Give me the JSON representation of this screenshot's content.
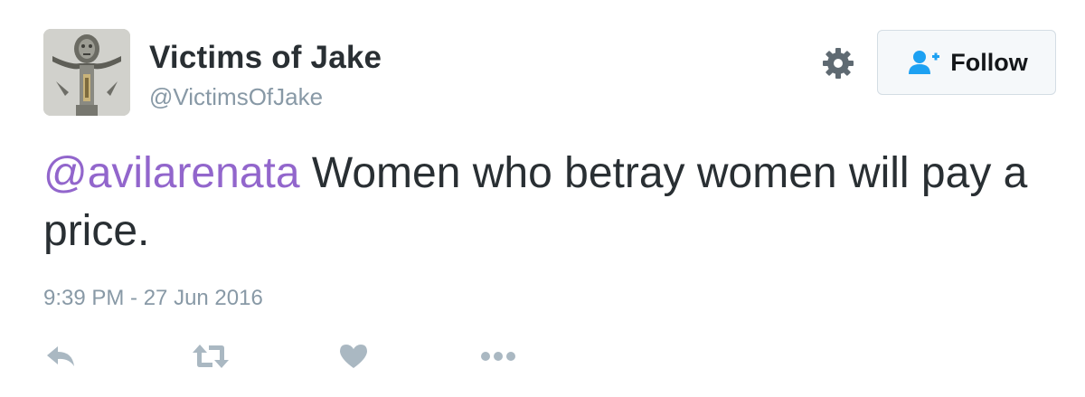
{
  "user": {
    "display_name": "Victims of Jake",
    "screen_name": "@VictimsOfJake"
  },
  "header": {
    "settings_icon": "gear-icon",
    "follow_label": "Follow",
    "follow_icon": "add-user-icon"
  },
  "tweet": {
    "mention": "@avilarenata",
    "text": " Women who betray women will pay a price.",
    "timestamp": "9:39 PM - 27 Jun 2016"
  },
  "actions": {
    "reply_icon": "reply-icon",
    "retweet_icon": "retweet-icon",
    "like_icon": "heart-icon",
    "more_icon": "more-dots-icon"
  },
  "colors": {
    "mention": "#9266cc",
    "text": "#292f33",
    "muted": "#8899a6",
    "action_icon": "#aab8c2",
    "follow_icon": "#1da1f2"
  }
}
